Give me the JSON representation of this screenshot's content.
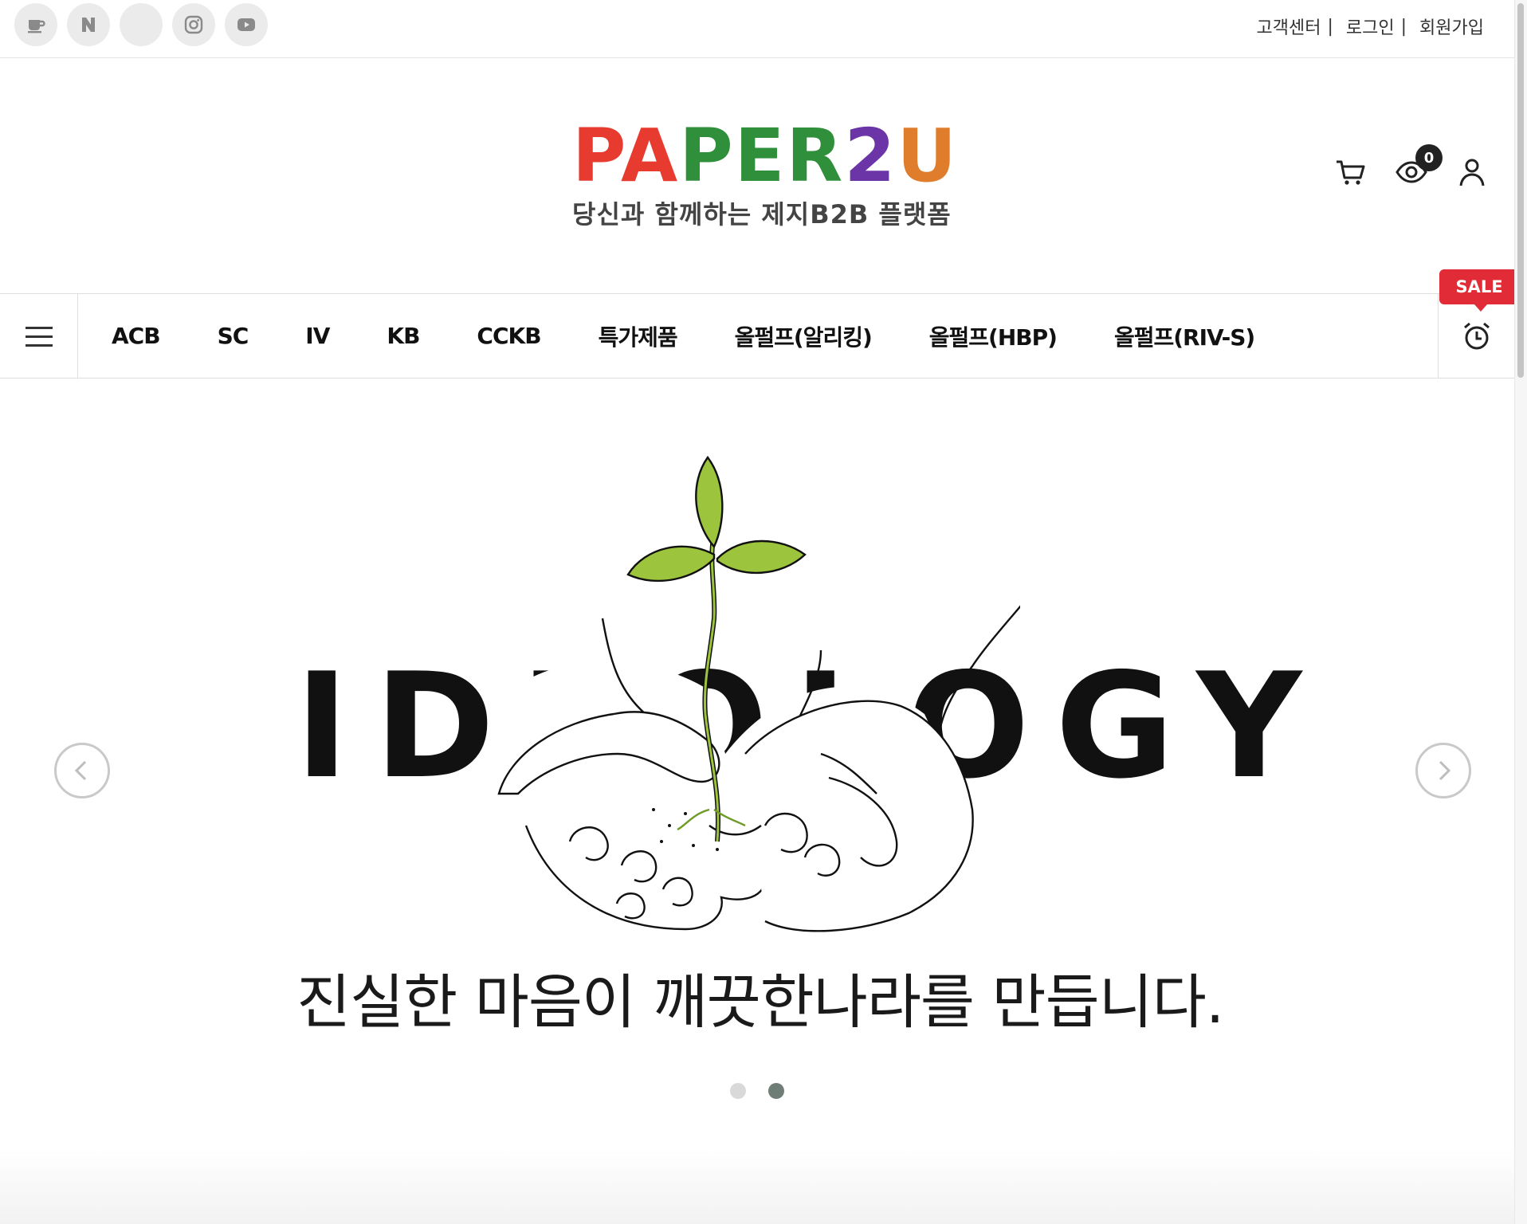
{
  "sns": [
    {
      "name": "cafe-icon",
      "label": "카페"
    },
    {
      "name": "naver-blog-icon",
      "label": "N"
    },
    {
      "name": "blank-sns-icon",
      "label": ""
    },
    {
      "name": "instagram-icon",
      "label": ""
    },
    {
      "name": "youtube-icon",
      "label": ""
    }
  ],
  "util_links": {
    "customer_center": "고객센터",
    "login": "로그인",
    "signup": "회원가입",
    "separator": "|"
  },
  "logo": {
    "letters": [
      {
        "char": "P",
        "color": "#e63b2e"
      },
      {
        "char": "A",
        "color": "#e63b2e"
      },
      {
        "char": "P",
        "color": "#2f8f3a"
      },
      {
        "char": "E",
        "color": "#2f8f3a"
      },
      {
        "char": "R",
        "color": "#2f8f3a"
      },
      {
        "char": "2",
        "color": "#6b35a8"
      },
      {
        "char": "U",
        "color": "#e07d2d"
      }
    ],
    "subtitle": "당신과 함께하는 제지B2B 플랫폼"
  },
  "header": {
    "cart_icon": "cart-icon",
    "recent_view_icon": "eye-icon",
    "recent_view_count": "0",
    "account_icon": "person-icon"
  },
  "nav": {
    "items": [
      "ACB",
      "SC",
      "IV",
      "KB",
      "CCKB",
      "특가제품",
      "올펄프(알리킹)",
      "올펄프(HBP)",
      "올펄프(RIV-S)"
    ],
    "sale_label": "SALE"
  },
  "hero": {
    "headline": "IDEOLOGY",
    "tagline": "진실한 마음이 깨끗한나라를 만듭니다.",
    "slides_total": 2,
    "active_slide": 2
  },
  "colors": {
    "sale_red": "#e12c37",
    "leaf_green": "#9cc43c",
    "dot_active": "#6f7d77"
  }
}
